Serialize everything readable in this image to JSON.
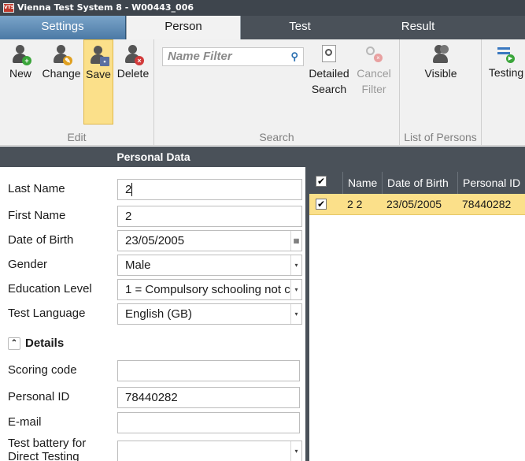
{
  "window": {
    "title": "Vienna Test System 8 - W00443_006",
    "app_badge": "VTS"
  },
  "tabs": [
    {
      "label": "Settings"
    },
    {
      "label": "Person"
    },
    {
      "label": "Test"
    },
    {
      "label": "Result"
    }
  ],
  "ribbon": {
    "edit": {
      "label": "Edit",
      "new": "New",
      "change": "Change",
      "save": "Save",
      "delete": "Delete"
    },
    "search": {
      "label": "Search",
      "name_filter_placeholder": "Name Filter",
      "detailed_line1": "Detailed",
      "detailed_line2": "Search",
      "cancel_line1": "Cancel",
      "cancel_line2": "Filter"
    },
    "list_of_persons": {
      "label": "List of Persons",
      "visible": "Visible"
    },
    "testing": {
      "label": "Testing"
    }
  },
  "personal_data": {
    "heading": "Personal Data",
    "fields": {
      "last_name": {
        "label": "Last Name",
        "value": "2"
      },
      "first_name": {
        "label": "First Name",
        "value": "2"
      },
      "dob": {
        "label": "Date of Birth",
        "value": "23/05/2005"
      },
      "gender": {
        "label": "Gender",
        "value": "Male"
      },
      "education": {
        "label": "Education Level",
        "value": "1 = Compulsory schooling not c"
      },
      "language": {
        "label": "Test Language",
        "value": "English (GB)"
      }
    },
    "details_heading": "Details",
    "details": {
      "scoring": {
        "label": "Scoring code",
        "value": ""
      },
      "personal_id": {
        "label": "Personal ID",
        "value": "78440282"
      },
      "email": {
        "label": "E-mail",
        "value": ""
      },
      "battery": {
        "label": "Test battery for Direct Testing",
        "value": ""
      }
    }
  },
  "grid": {
    "columns": [
      "Name",
      "Date of Birth",
      "Personal ID"
    ],
    "rows": [
      {
        "checked": true,
        "name": "2 2",
        "dob": "23/05/2005",
        "personal_id": "78440282"
      }
    ]
  },
  "colors": {
    "dark_header": "#4a5159",
    "selected_row": "#fbe08a",
    "settings_tab": "#5d89b5"
  }
}
